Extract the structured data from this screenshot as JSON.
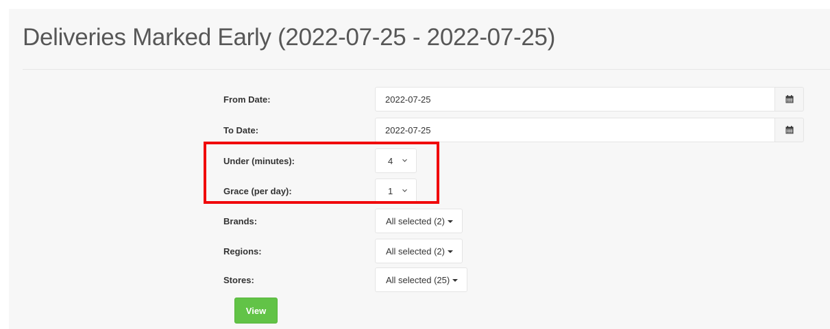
{
  "page": {
    "title": "Deliveries Marked Early (2022-07-25 - 2022-07-25)"
  },
  "form": {
    "from_date": {
      "label": "From Date:",
      "value": "2022-07-25",
      "icon": "calendar-icon"
    },
    "to_date": {
      "label": "To Date:",
      "value": "2022-07-25",
      "icon": "calendar-icon"
    },
    "under_minutes": {
      "label": "Under (minutes):",
      "value": "4"
    },
    "grace_per_day": {
      "label": "Grace (per day):",
      "value": "1"
    },
    "brands": {
      "label": "Brands:",
      "value": "All selected (2)"
    },
    "regions": {
      "label": "Regions:",
      "value": "All selected (2)"
    },
    "stores": {
      "label": "Stores:",
      "value": "All selected (25)"
    },
    "view_button": "View"
  },
  "colors": {
    "panel_background": "#f7f7f7",
    "view_button": "#62c347",
    "highlight_box": "#f0080b"
  }
}
